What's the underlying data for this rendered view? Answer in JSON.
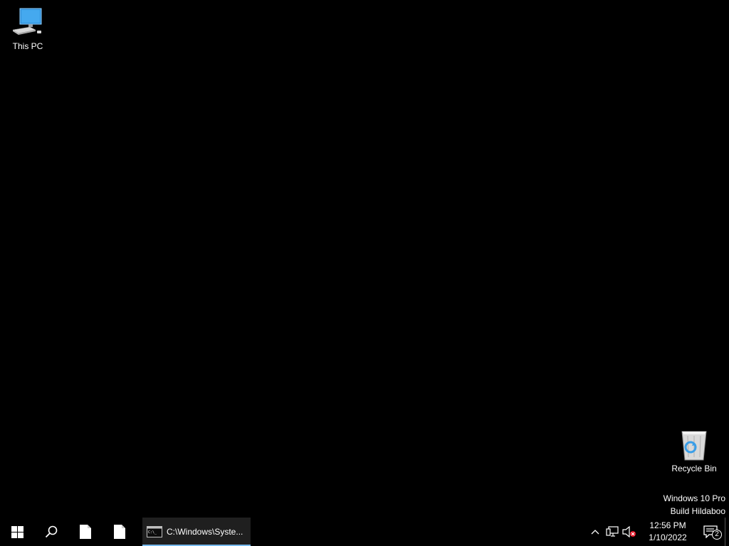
{
  "desktop": {
    "icons": [
      {
        "label": "This PC",
        "icon": "this-pc-icon"
      },
      {
        "label": "Recycle Bin",
        "icon": "recycle-bin-icon"
      }
    ],
    "watermark": {
      "line1": "Windows 10 Pro",
      "line2": "Build Hildaboo"
    }
  },
  "taskbar": {
    "start_icon": "windows-logo-icon",
    "search_icon": "search-icon",
    "pinned": [
      {
        "icon": "blank-document-icon"
      },
      {
        "icon": "blank-document-icon"
      }
    ],
    "running_app": {
      "label": "C:\\Windows\\Syste...",
      "icon": "command-prompt-icon"
    },
    "tray": {
      "chevron_icon": "chevron-up-icon",
      "network_icon": "network-icon",
      "volume_icon": "volume-muted-icon",
      "time": "12:56 PM",
      "date": "1/10/2022",
      "notification_count": "2"
    }
  },
  "colors": {
    "background": "#000000",
    "accent": "#76b9ed",
    "text": "#ffffff"
  }
}
